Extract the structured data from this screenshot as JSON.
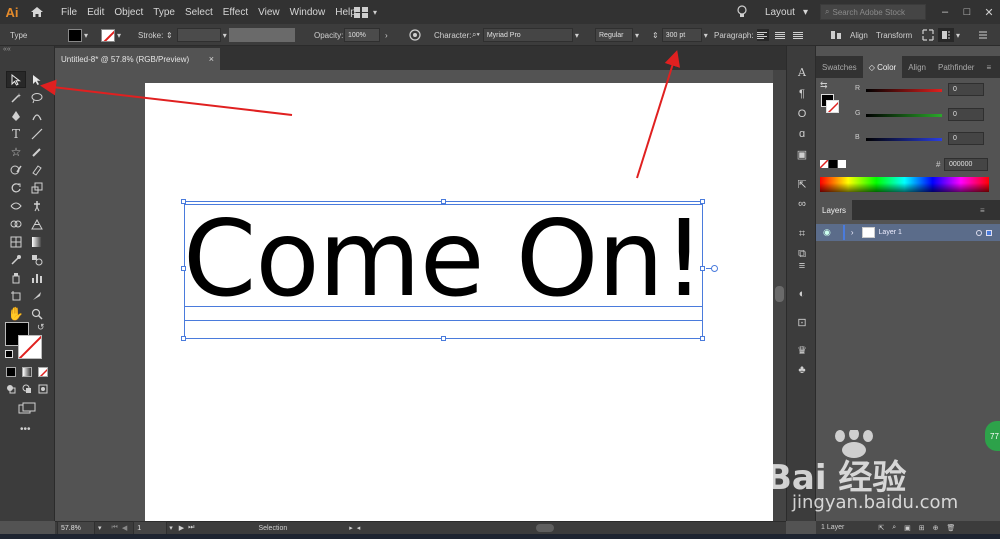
{
  "app": {
    "logo": "Ai"
  },
  "menu": [
    "File",
    "Edit",
    "Object",
    "Type",
    "Select",
    "Effect",
    "View",
    "Window",
    "Help"
  ],
  "menubar_right": {
    "workspace": "Layout",
    "search_placeholder": "Search Adobe Stock"
  },
  "control": {
    "selection_type": "Type",
    "stroke_label": "Stroke:",
    "opacity_label": "Opacity:",
    "opacity_value": "100%",
    "character_label": "Character:",
    "font_family": "Myriad Pro",
    "font_style": "Regular",
    "font_size": "300 pt",
    "paragraph_label": "Paragraph:",
    "align_label": "Align",
    "transform_label": "Transform"
  },
  "document": {
    "tab_title": "Untitled-8* @ 57.8% (RGB/Preview)",
    "close_glyph": "×"
  },
  "artboard": {
    "text": "Come On!"
  },
  "status": {
    "zoom": "57.8%",
    "artboard_number": "1",
    "tool_name": "Selection"
  },
  "panels": {
    "color_tabs": [
      "Swatches",
      "Color",
      "Align",
      "Pathfinder"
    ],
    "active_color_tab": "Color",
    "channels": [
      {
        "label": "R",
        "value": "0",
        "color": "#e0201e"
      },
      {
        "label": "G",
        "value": "0",
        "color": "#2aa82a"
      },
      {
        "label": "B",
        "value": "0",
        "color": "#2a3ee0"
      }
    ],
    "hex_label": "#",
    "hex_value": "000000",
    "layers_tab": "Layers",
    "layers": [
      {
        "name": "Layer 1"
      }
    ],
    "layers_count": "1 Layer"
  },
  "watermark": {
    "brand": "Bai 经验",
    "url": "jingyan.baidu.com",
    "badge": "77"
  },
  "colors": {
    "selection": "#4a7bdc",
    "arrow": "#e02020",
    "accent": "#e58b2b"
  }
}
